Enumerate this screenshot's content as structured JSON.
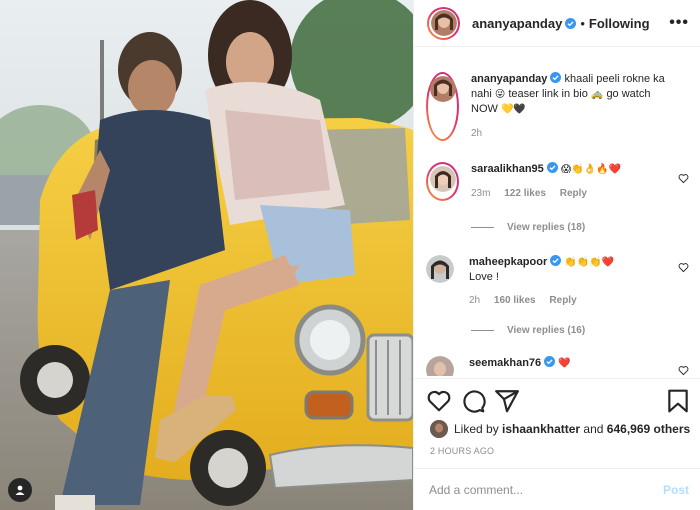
{
  "colors": {
    "accent_blue": "#0095f6",
    "post_disabled": "#b2dffc",
    "muted_text": "#8e8e8e",
    "primary_text": "#262626",
    "heart_red": "#ed4956",
    "taxi_yellow": "#f2c230"
  },
  "header": {
    "username": "ananyapanday",
    "separator": "•",
    "follow_status": "Following",
    "more_label": "•••"
  },
  "caption": {
    "username": "ananyapanday",
    "text_part1": "khaali peeli rokne ka nahi",
    "emoji1": "😜",
    "text_part2": "teaser link in bio",
    "emoji2": "🚕",
    "text_part3": "go watch NOW",
    "emoji3": "💛🖤",
    "time": "2h"
  },
  "comments": [
    {
      "username": "saraalikhan95",
      "emojis": "😱👏👌🔥❤️",
      "time": "23m",
      "likes": "122 likes",
      "reply": "Reply",
      "view_replies": "View replies (18)"
    },
    {
      "username": "maheepkapoor",
      "emojis": "👏👏👏❤️",
      "text": "Love !",
      "time": "2h",
      "likes": "160 likes",
      "reply": "Reply",
      "view_replies": "View replies (16)"
    },
    {
      "username": "seemakhan76",
      "emojis": "❤️"
    }
  ],
  "actions": {
    "like_icon": "heart-outline-icon",
    "comment_icon": "comment-icon",
    "share_icon": "paper-plane-icon",
    "save_icon": "bookmark-icon"
  },
  "likes_summary": {
    "prefix": "Liked by",
    "user": "ishaankhatter",
    "middle": "and",
    "others": "646,969 others"
  },
  "time_ago": "2 HOURS AGO",
  "add_comment": {
    "placeholder": "Add a comment...",
    "post_label": "Post"
  }
}
